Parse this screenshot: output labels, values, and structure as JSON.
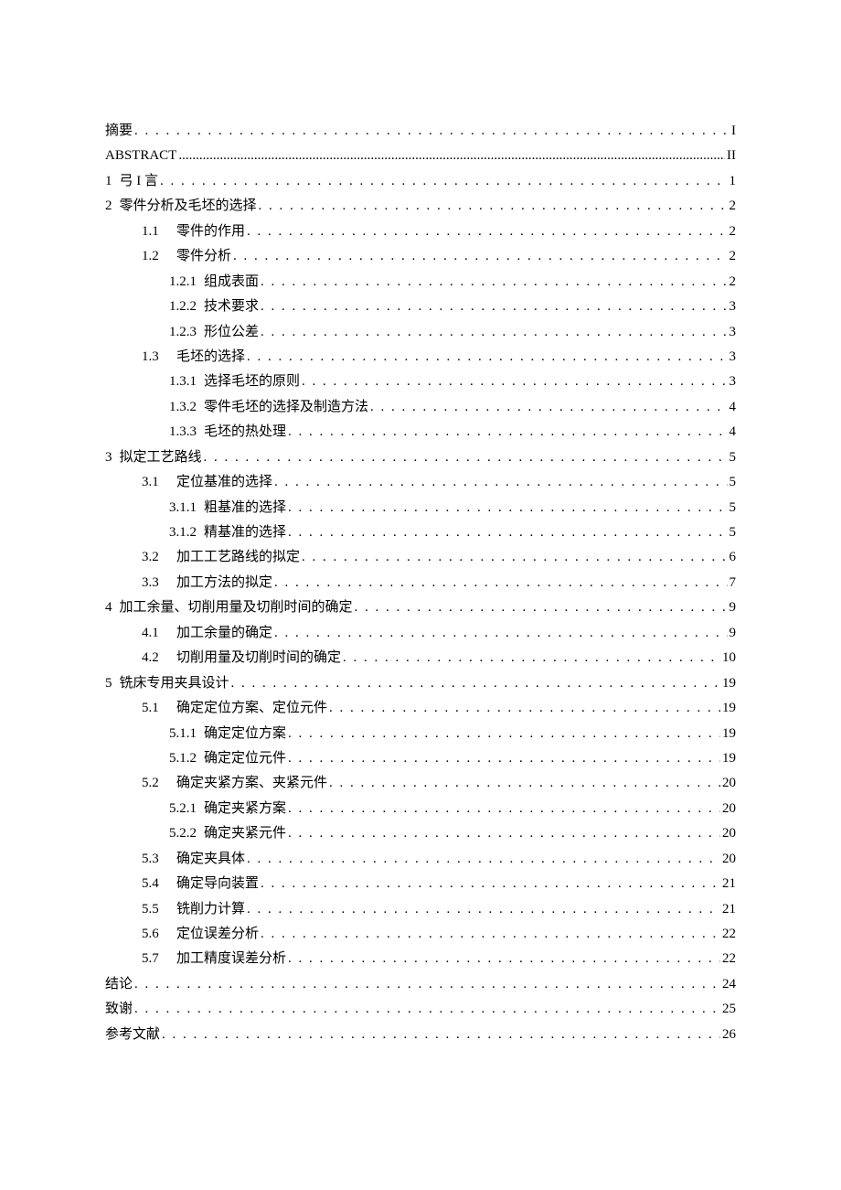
{
  "toc": [
    {
      "indent": 0,
      "num": "",
      "text": "摘要",
      "page": "I",
      "dot": "spaced",
      "cls": ""
    },
    {
      "indent": 0,
      "num": "",
      "text": "ABSTRACT",
      "page": "II",
      "dot": "solid",
      "cls": "abstract-line"
    },
    {
      "indent": 0,
      "num": "1",
      "text": "弓 I 言",
      "page": "1",
      "dot": "spaced",
      "cls": ""
    },
    {
      "indent": 0,
      "num": "2",
      "text": "零件分析及毛坯的选择",
      "page": "2",
      "dot": "spaced",
      "cls": ""
    },
    {
      "indent": 1,
      "num": "1.1",
      "text": "零件的作用",
      "page": "2",
      "dot": "spaced",
      "cls": ""
    },
    {
      "indent": 1,
      "num": "1.2",
      "text": "零件分析",
      "page": "2",
      "dot": "spaced",
      "cls": ""
    },
    {
      "indent": 2,
      "num": "1.2.1",
      "text": "组成表面",
      "page": "2",
      "dot": "spaced",
      "cls": ""
    },
    {
      "indent": 2,
      "num": "1.2.2",
      "text": "技术要求",
      "page": "3",
      "dot": "spaced",
      "cls": ""
    },
    {
      "indent": 2,
      "num": "1.2.3",
      "text": "形位公差",
      "page": "3",
      "dot": "spaced",
      "cls": ""
    },
    {
      "indent": 1,
      "num": "1.3",
      "text": "毛坯的选择",
      "page": "3",
      "dot": "spaced",
      "cls": ""
    },
    {
      "indent": 2,
      "num": "1.3.1",
      "text": "选择毛坯的原则",
      "page": "3",
      "dot": "spaced",
      "cls": ""
    },
    {
      "indent": 2,
      "num": "1.3.2",
      "text": "零件毛坯的选择及制造方法",
      "page": "4",
      "dot": "spaced",
      "cls": ""
    },
    {
      "indent": 2,
      "num": "1.3.3",
      "text": "毛坯的热处理",
      "page": "4",
      "dot": "spaced",
      "cls": ""
    },
    {
      "indent": 0,
      "num": "3",
      "text": "拟定工艺路线",
      "page": "5",
      "dot": "spaced",
      "cls": ""
    },
    {
      "indent": 1,
      "num": "3.1",
      "text": "定位基准的选择",
      "page": "5",
      "dot": "spaced",
      "cls": ""
    },
    {
      "indent": 2,
      "num": "3.1.1",
      "text": "粗基准的选择",
      "page": "5",
      "dot": "spaced",
      "cls": ""
    },
    {
      "indent": 2,
      "num": "3.1.2",
      "text": "精基准的选择",
      "page": "5",
      "dot": "spaced",
      "cls": ""
    },
    {
      "indent": 1,
      "num": "3.2",
      "text": "加工工艺路线的拟定",
      "page": "6",
      "dot": "spaced",
      "cls": ""
    },
    {
      "indent": 1,
      "num": "3.3",
      "text": "加工方法的拟定",
      "page": "7",
      "dot": "spaced",
      "cls": ""
    },
    {
      "indent": 0,
      "num": "4",
      "text": "加工余量、切削用量及切削时间的确定",
      "page": "9",
      "dot": "spaced",
      "cls": ""
    },
    {
      "indent": 1,
      "num": "4.1",
      "text": "加工余量的确定",
      "page": "9",
      "dot": "spaced",
      "cls": ""
    },
    {
      "indent": 1,
      "num": "4.2",
      "text": "切削用量及切削时间的确定",
      "page": "10",
      "dot": "spaced",
      "cls": ""
    },
    {
      "indent": 0,
      "num": "5",
      "text": "铣床专用夹具设计",
      "page": "19",
      "dot": "spaced",
      "cls": ""
    },
    {
      "indent": 1,
      "num": "5.1",
      "text": "确定定位方案、定位元件",
      "page": "19",
      "dot": "spaced",
      "cls": ""
    },
    {
      "indent": 2,
      "num": "5.1.1",
      "text": "确定定位方案",
      "page": "19",
      "dot": "spaced",
      "cls": ""
    },
    {
      "indent": 2,
      "num": "5.1.2",
      "text": "确定定位元件",
      "page": "19",
      "dot": "spaced",
      "cls": ""
    },
    {
      "indent": 1,
      "num": "5.2",
      "text": "确定夹紧方案、夹紧元件",
      "page": "20",
      "dot": "spaced",
      "cls": ""
    },
    {
      "indent": 2,
      "num": "5.2.1",
      "text": "确定夹紧方案",
      "page": "20",
      "dot": "spaced",
      "cls": ""
    },
    {
      "indent": 2,
      "num": "5.2.2",
      "text": "确定夹紧元件",
      "page": "20",
      "dot": "spaced",
      "cls": ""
    },
    {
      "indent": 1,
      "num": "5.3",
      "text": "确定夹具体",
      "page": "20",
      "dot": "spaced",
      "cls": ""
    },
    {
      "indent": 1,
      "num": "5.4",
      "text": "确定导向装置",
      "page": "21",
      "dot": "spaced",
      "cls": ""
    },
    {
      "indent": 1,
      "num": "5.5",
      "text": "铣削力计算",
      "page": "21",
      "dot": "spaced",
      "cls": ""
    },
    {
      "indent": 1,
      "num": "5.6",
      "text": "定位误差分析",
      "page": "22",
      "dot": "spaced",
      "cls": ""
    },
    {
      "indent": 1,
      "num": "5.7",
      "text": "加工精度误差分析",
      "page": "22",
      "dot": "spaced",
      "cls": ""
    },
    {
      "indent": 0,
      "num": "",
      "text": "结论",
      "page": "24",
      "dot": "spaced",
      "cls": ""
    },
    {
      "indent": 0,
      "num": "",
      "text": "致谢",
      "page": "25",
      "dot": "spaced",
      "cls": ""
    },
    {
      "indent": 0,
      "num": "",
      "text": "参考文献",
      "page": "26",
      "dot": "spaced",
      "cls": ""
    }
  ]
}
